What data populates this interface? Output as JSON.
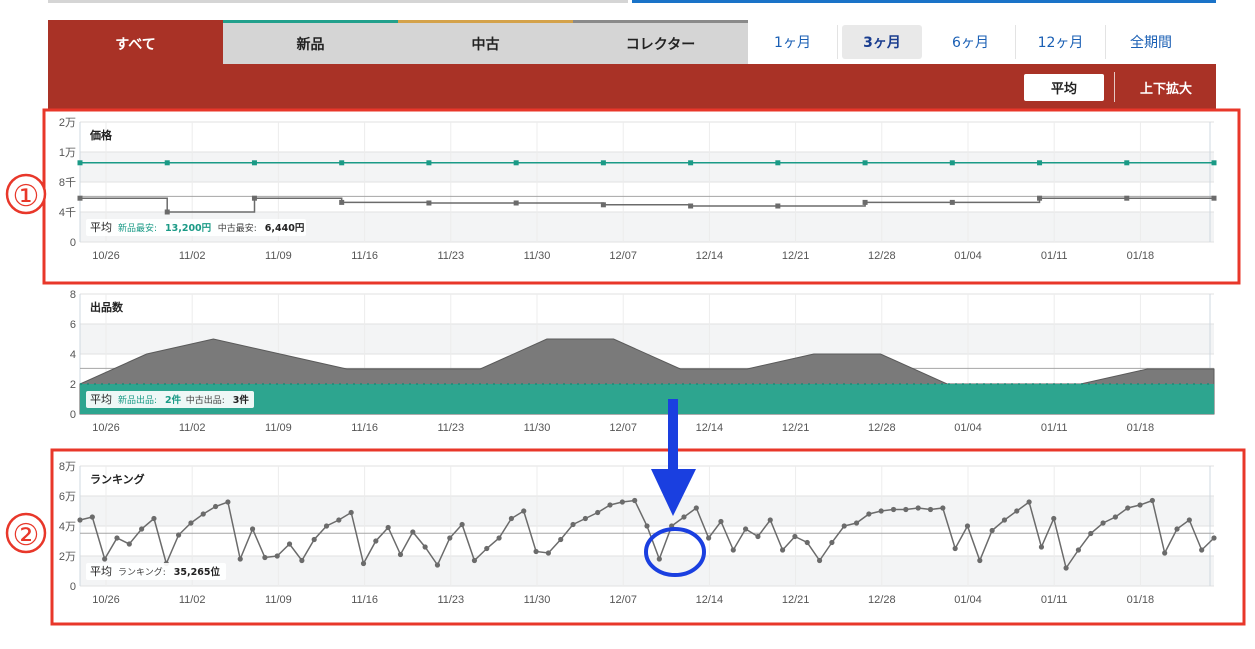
{
  "category_tabs": [
    {
      "label": "すべて",
      "active": true
    },
    {
      "label": "新品",
      "active": false
    },
    {
      "label": "中古",
      "active": false
    },
    {
      "label": "コレクター",
      "active": false
    }
  ],
  "period_tabs": [
    {
      "label": "1ヶ月",
      "selected": false
    },
    {
      "label": "3ヶ月",
      "selected": true
    },
    {
      "label": "6ヶ月",
      "selected": false
    },
    {
      "label": "12ヶ月",
      "selected": false
    },
    {
      "label": "全期間",
      "selected": false
    }
  ],
  "toolbar": {
    "average_label": "平均",
    "zoom_label": "上下拡大"
  },
  "annotations": {
    "marker_1": "①",
    "marker_2": "②"
  },
  "colors": {
    "brand_red": "#a93226",
    "new_green": "#22a08c",
    "used_grey": "#6b6b6b",
    "highlight_red": "#e8372a",
    "highlight_blue": "#1a3fe0"
  },
  "chart_data": [
    {
      "type": "line",
      "title": "価格",
      "x_tick_labels": [
        "10/26",
        "11/02",
        "11/09",
        "11/16",
        "11/23",
        "11/30",
        "12/07",
        "12/14",
        "12/21",
        "12/28",
        "01/04",
        "01/11",
        "01/18"
      ],
      "y_tick_labels": [
        "2万",
        "1万",
        "8千",
        "4千",
        "0"
      ],
      "ylim": [
        0,
        20000
      ],
      "series": [
        {
          "name": "新品",
          "color": "#22a08c",
          "values": [
            13200,
            13200,
            13200,
            13200,
            13200,
            13200,
            13200,
            13200,
            13200,
            13200,
            13200,
            13200,
            13200,
            13200
          ]
        },
        {
          "name": "中古",
          "color": "#6b6b6b",
          "values": [
            7300,
            5000,
            7300,
            6600,
            6500,
            6500,
            6200,
            6000,
            6000,
            6600,
            6600,
            7300,
            7300,
            7300
          ]
        }
      ],
      "average": {
        "label": "平均",
        "items": [
          {
            "name": "新品最安:",
            "value": "13,200円"
          },
          {
            "name": "中古最安:",
            "value": "6,440円"
          }
        ]
      }
    },
    {
      "type": "area",
      "title": "出品数",
      "x_tick_labels": [
        "10/26",
        "11/02",
        "11/09",
        "11/16",
        "11/23",
        "11/30",
        "12/07",
        "12/14",
        "12/21",
        "12/28",
        "01/04",
        "01/11",
        "01/18"
      ],
      "y_tick_labels": [
        "8",
        "6",
        "4",
        "2",
        "0"
      ],
      "ylim": [
        0,
        8
      ],
      "series": [
        {
          "name": "新品",
          "color": "#2da58f",
          "values": [
            2,
            2,
            2,
            2,
            2,
            2,
            2,
            2,
            2,
            2,
            2,
            2,
            2,
            2
          ]
        },
        {
          "name": "中古",
          "color": "#7a7a7a",
          "values": [
            2,
            4,
            5,
            4,
            3,
            3,
            3,
            5,
            5,
            3,
            3,
            4,
            4,
            2,
            2,
            2,
            3,
            3
          ]
        }
      ],
      "average": {
        "label": "平均",
        "items": [
          {
            "name": "新品出品:",
            "value": "2件"
          },
          {
            "name": "中古出品:",
            "value": "3件"
          }
        ]
      }
    },
    {
      "type": "line",
      "title": "ランキング",
      "x_tick_labels": [
        "10/26",
        "11/02",
        "11/09",
        "11/16",
        "11/23",
        "11/30",
        "12/07",
        "12/14",
        "12/21",
        "12/28",
        "01/04",
        "01/11",
        "01/18"
      ],
      "y_tick_labels": [
        "8万",
        "6万",
        "4万",
        "2万",
        "0"
      ],
      "ylim": [
        0,
        80000
      ],
      "series": [
        {
          "name": "ランキング",
          "color": "#6b6b6b",
          "values": [
            44000,
            46000,
            18000,
            32000,
            28000,
            38000,
            45000,
            15000,
            34000,
            42000,
            48000,
            53000,
            56000,
            18000,
            38000,
            19000,
            20000,
            28000,
            17000,
            31000,
            40000,
            44000,
            49000,
            15000,
            30000,
            39000,
            21000,
            36000,
            26000,
            14000,
            32000,
            41000,
            17000,
            25000,
            32000,
            45000,
            50000,
            23000,
            22000,
            31000,
            41000,
            45000,
            49000,
            54000,
            56000,
            57000,
            40000,
            18000,
            40000,
            46000,
            52000,
            32000,
            43000,
            24000,
            38000,
            33000,
            44000,
            24000,
            33000,
            29000,
            17000,
            29000,
            40000,
            42000,
            48000,
            50000,
            51000,
            51000,
            52000,
            51000,
            52000,
            25000,
            40000,
            17000,
            37000,
            44000,
            50000,
            56000,
            26000,
            45000,
            12000,
            24000,
            35000,
            42000,
            46000,
            52000,
            54000,
            57000,
            22000,
            38000,
            44000,
            24000,
            32000
          ]
        }
      ],
      "average": {
        "label": "平均",
        "items": [
          {
            "name": "ランキング:",
            "value": "35,265位"
          }
        ]
      }
    }
  ]
}
